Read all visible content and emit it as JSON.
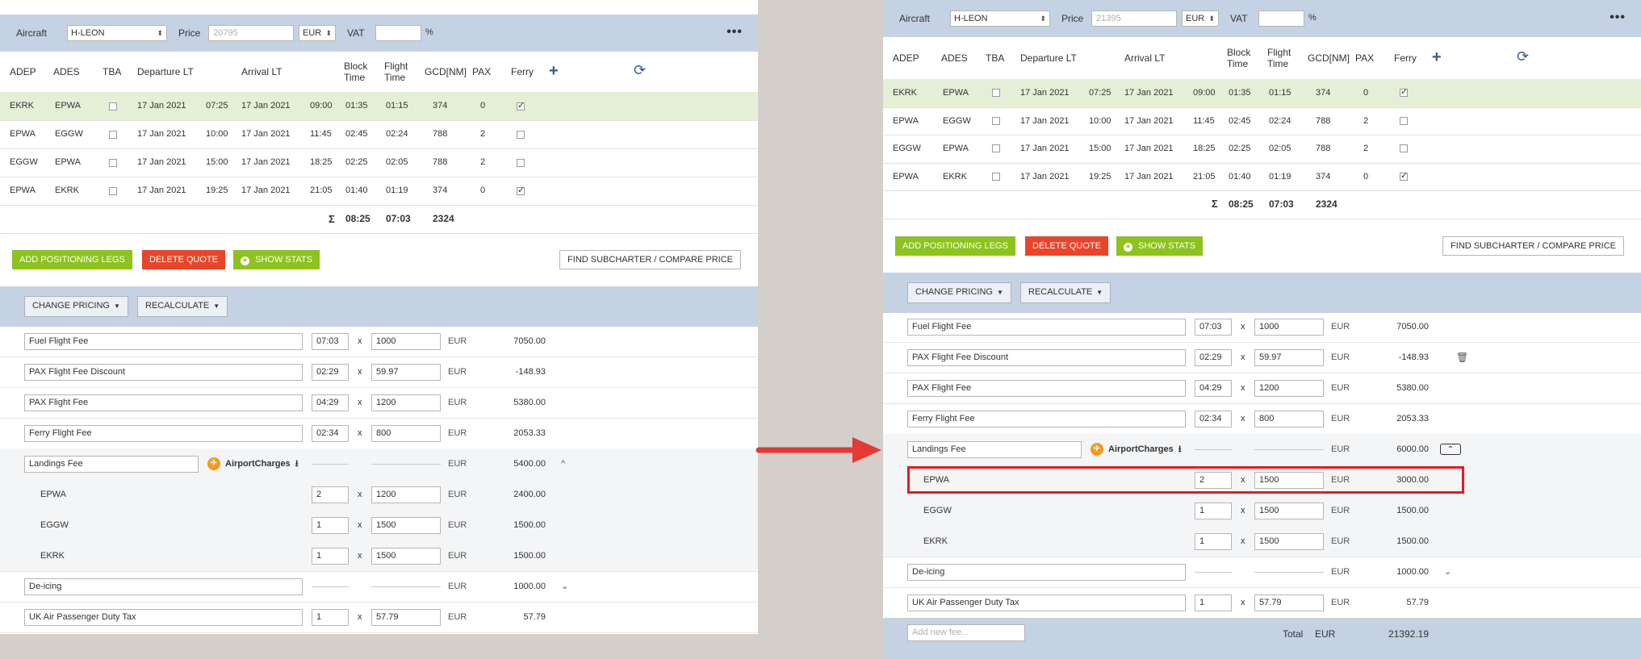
{
  "labels": {
    "aircraft": "Aircraft",
    "price": "Price",
    "vat": "VAT",
    "percent": "%",
    "more": "•••",
    "sigma": "Σ",
    "x": "x",
    "eur": "EUR",
    "airport_charges": "AirportCharges",
    "total": "Total"
  },
  "columns": [
    "ADEP",
    "ADES",
    "TBA",
    "Departure LT",
    "Arrival LT",
    "Block Time",
    "Flight Time",
    "GCD[NM]",
    "PAX",
    "Ferry"
  ],
  "buttons": {
    "add_positioning": "ADD POSITIONING LEGS",
    "delete_quote": "DELETE QUOTE",
    "show_stats": "SHOW STATS",
    "find_subcharter": "FIND SUBCHARTER / COMPARE PRICE",
    "change_pricing": "CHANGE PRICING",
    "recalculate": "RECALCULATE"
  },
  "left": {
    "aircraft": "H-LEON",
    "price": "20795",
    "currency": "EUR",
    "vat": "",
    "legs": [
      {
        "adep": "EKRK",
        "ades": "EPWA",
        "tba": false,
        "dep_date": "17 Jan 2021",
        "dep_time": "07:25",
        "arr_date": "17 Jan 2021",
        "arr_time": "09:00",
        "block": "01:35",
        "flight": "01:15",
        "gcd": "374",
        "pax": "0",
        "ferry": true
      },
      {
        "adep": "EPWA",
        "ades": "EGGW",
        "tba": false,
        "dep_date": "17 Jan 2021",
        "dep_time": "10:00",
        "arr_date": "17 Jan 2021",
        "arr_time": "11:45",
        "block": "02:45",
        "flight": "02:24",
        "gcd": "788",
        "pax": "2",
        "ferry": false
      },
      {
        "adep": "EGGW",
        "ades": "EPWA",
        "tba": false,
        "dep_date": "17 Jan 2021",
        "dep_time": "15:00",
        "arr_date": "17 Jan 2021",
        "arr_time": "18:25",
        "block": "02:25",
        "flight": "02:05",
        "gcd": "788",
        "pax": "2",
        "ferry": false
      },
      {
        "adep": "EPWA",
        "ades": "EKRK",
        "tba": false,
        "dep_date": "17 Jan 2021",
        "dep_time": "19:25",
        "arr_date": "17 Jan 2021",
        "arr_time": "21:05",
        "block": "01:40",
        "flight": "01:19",
        "gcd": "374",
        "pax": "0",
        "ferry": true
      }
    ],
    "totals": {
      "block": "08:25",
      "flight": "07:03",
      "gcd": "2324"
    },
    "fees": [
      {
        "kind": "fee",
        "name": "Fuel Flight Fee",
        "qty": "07:03",
        "rate": "1000",
        "currency": "EUR",
        "amount": "7050.00"
      },
      {
        "kind": "fee",
        "name": "PAX Flight Fee Discount",
        "qty": "02:29",
        "rate": "59.97",
        "currency": "EUR",
        "amount": "-148.93"
      },
      {
        "kind": "fee",
        "name": "PAX Flight Fee",
        "qty": "04:29",
        "rate": "1200",
        "currency": "EUR",
        "amount": "5380.00"
      },
      {
        "kind": "fee",
        "name": "Ferry Flight Fee",
        "qty": "02:34",
        "rate": "800",
        "currency": "EUR",
        "amount": "2053.33"
      },
      {
        "kind": "landing",
        "name": "Landings Fee",
        "currency": "EUR",
        "amount": "5400.00",
        "chevron": "^"
      },
      {
        "kind": "sub",
        "name": "EPWA",
        "qty": "2",
        "rate": "1200",
        "currency": "EUR",
        "amount": "2400.00"
      },
      {
        "kind": "sub",
        "name": "EGGW",
        "qty": "1",
        "rate": "1500",
        "currency": "EUR",
        "amount": "1500.00"
      },
      {
        "kind": "sub",
        "name": "EKRK",
        "qty": "1",
        "rate": "1500",
        "currency": "EUR",
        "amount": "1500.00"
      },
      {
        "kind": "noqty",
        "name": "De-icing",
        "currency": "EUR",
        "amount": "1000.00",
        "chevron": "⌄"
      },
      {
        "kind": "fee",
        "name": "UK Air Passenger Duty Tax",
        "qty": "1",
        "rate": "57.79",
        "currency": "EUR",
        "amount": "57.79"
      }
    ]
  },
  "right": {
    "aircraft": "H-LEON",
    "price": "21395",
    "currency": "EUR",
    "vat": "",
    "legs": [
      {
        "adep": "EKRK",
        "ades": "EPWA",
        "tba": false,
        "dep_date": "17 Jan 2021",
        "dep_time": "07:25",
        "arr_date": "17 Jan 2021",
        "arr_time": "09:00",
        "block": "01:35",
        "flight": "01:15",
        "gcd": "374",
        "pax": "0",
        "ferry": true
      },
      {
        "adep": "EPWA",
        "ades": "EGGW",
        "tba": false,
        "dep_date": "17 Jan 2021",
        "dep_time": "10:00",
        "arr_date": "17 Jan 2021",
        "arr_time": "11:45",
        "block": "02:45",
        "flight": "02:24",
        "gcd": "788",
        "pax": "2",
        "ferry": false
      },
      {
        "adep": "EGGW",
        "ades": "EPWA",
        "tba": false,
        "dep_date": "17 Jan 2021",
        "dep_time": "15:00",
        "arr_date": "17 Jan 2021",
        "arr_time": "18:25",
        "block": "02:25",
        "flight": "02:05",
        "gcd": "788",
        "pax": "2",
        "ferry": false
      },
      {
        "adep": "EPWA",
        "ades": "EKRK",
        "tba": false,
        "dep_date": "17 Jan 2021",
        "dep_time": "19:25",
        "arr_date": "17 Jan 2021",
        "arr_time": "21:05",
        "block": "01:40",
        "flight": "01:19",
        "gcd": "374",
        "pax": "0",
        "ferry": true
      }
    ],
    "totals": {
      "block": "08:25",
      "flight": "07:03",
      "gcd": "2324"
    },
    "fees": [
      {
        "kind": "fee",
        "name": "Fuel Flight Fee",
        "qty": "07:03",
        "rate": "1000",
        "currency": "EUR",
        "amount": "7050.00"
      },
      {
        "kind": "fee",
        "name": "PAX Flight Fee Discount",
        "qty": "02:29",
        "rate": "59.97",
        "currency": "EUR",
        "amount": "-148.93",
        "trash": true
      },
      {
        "kind": "fee",
        "name": "PAX Flight Fee",
        "qty": "04:29",
        "rate": "1200",
        "currency": "EUR",
        "amount": "5380.00"
      },
      {
        "kind": "fee",
        "name": "Ferry Flight Fee",
        "qty": "02:34",
        "rate": "800",
        "currency": "EUR",
        "amount": "2053.33"
      },
      {
        "kind": "landing",
        "name": "Landings Fee",
        "currency": "EUR",
        "amount": "6000.00",
        "collapse": true
      },
      {
        "kind": "sub",
        "name": "EPWA",
        "qty": "2",
        "rate": "1500",
        "currency": "EUR",
        "amount": "3000.00",
        "highlight": true
      },
      {
        "kind": "sub",
        "name": "EGGW",
        "qty": "1",
        "rate": "1500",
        "currency": "EUR",
        "amount": "1500.00"
      },
      {
        "kind": "sub",
        "name": "EKRK",
        "qty": "1",
        "rate": "1500",
        "currency": "EUR",
        "amount": "1500.00"
      },
      {
        "kind": "noqty",
        "name": "De-icing",
        "currency": "EUR",
        "amount": "1000.00",
        "chevron": "⌄"
      },
      {
        "kind": "fee",
        "name": "UK Air Passenger Duty Tax",
        "qty": "1",
        "rate": "57.79",
        "currency": "EUR",
        "amount": "57.79"
      }
    ],
    "footer": {
      "add_placeholder": "Add new fee...",
      "total_currency": "EUR",
      "total": "21392.19"
    }
  },
  "colors": {
    "header_bg": "#c5d2e3",
    "highlight_row": "#e5efd6",
    "green": "#8dc21f",
    "red": "#e8452a",
    "arrow": "#e53935",
    "box": "#e31b23"
  }
}
